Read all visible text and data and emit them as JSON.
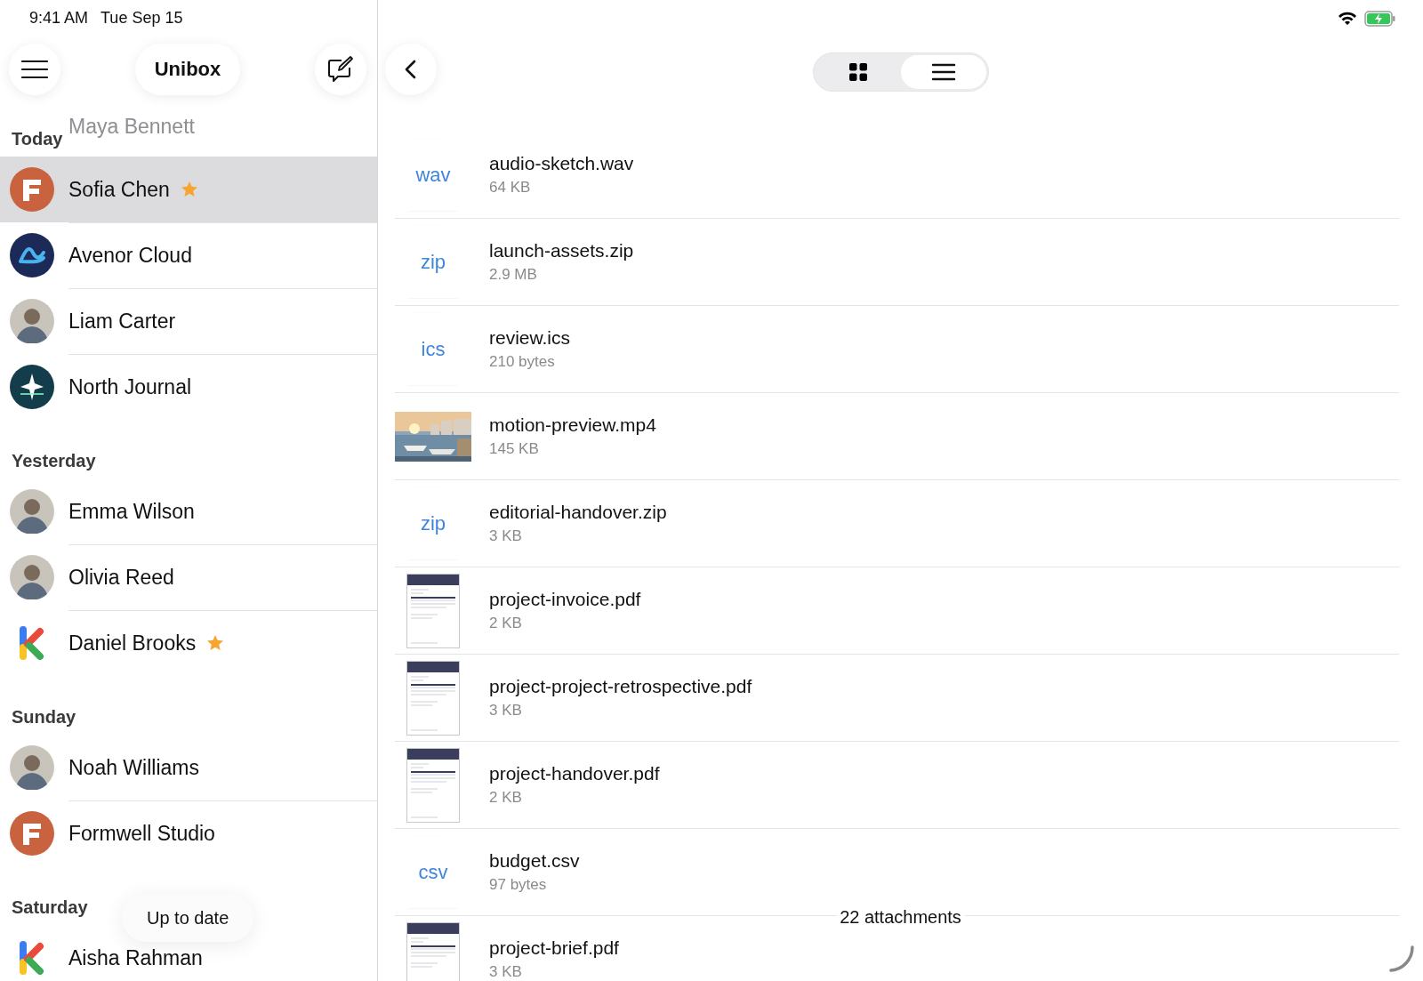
{
  "status_bar": {
    "time": "9:41 AM",
    "date": "Tue Sep 15"
  },
  "sidebar": {
    "title": "Unibox",
    "under_header": "Maya Bennett",
    "sections": [
      {
        "label": "Today",
        "contacts": [
          {
            "name": "Sofia Chen",
            "kind": "brand-f",
            "starred": true,
            "selected": true
          },
          {
            "name": "Avenor Cloud",
            "kind": "brand-loop",
            "starred": false,
            "selected": false
          },
          {
            "name": "Liam Carter",
            "kind": "person",
            "starred": false,
            "selected": false
          },
          {
            "name": "North Journal",
            "kind": "brand-star",
            "starred": false,
            "selected": false
          }
        ]
      },
      {
        "label": "Yesterday",
        "contacts": [
          {
            "name": "Emma Wilson",
            "kind": "person",
            "starred": false,
            "selected": false
          },
          {
            "name": "Olivia Reed",
            "kind": "person",
            "starred": false,
            "selected": false
          },
          {
            "name": "Daniel Brooks",
            "kind": "brand-k",
            "starred": true,
            "selected": false
          }
        ]
      },
      {
        "label": "Sunday",
        "contacts": [
          {
            "name": "Noah Williams",
            "kind": "person",
            "starred": false,
            "selected": false
          },
          {
            "name": "Formwell Studio",
            "kind": "brand-f",
            "starred": false,
            "selected": false
          }
        ]
      },
      {
        "label": "Saturday",
        "contacts": [
          {
            "name": "Aisha Rahman",
            "kind": "brand-k",
            "starred": false,
            "selected": false
          }
        ]
      }
    ]
  },
  "toast": "Up to date",
  "attachments": {
    "view_modes": [
      {
        "kind": "grid",
        "selected": false
      },
      {
        "kind": "list",
        "selected": true
      }
    ],
    "files": [
      {
        "name": "audio-sketch.wav",
        "size": "64 KB",
        "kind": "doc",
        "ext": "wav"
      },
      {
        "name": "launch-assets.zip",
        "size": "2.9 MB",
        "kind": "doc",
        "ext": "zip"
      },
      {
        "name": "review.ics",
        "size": "210 bytes",
        "kind": "doc",
        "ext": "ics"
      },
      {
        "name": "motion-preview.mp4",
        "size": "145 KB",
        "kind": "picture"
      },
      {
        "name": "editorial-handover.zip",
        "size": "3 KB",
        "kind": "doc",
        "ext": "zip"
      },
      {
        "name": "project-invoice.pdf",
        "size": "2 KB",
        "kind": "pdf"
      },
      {
        "name": "project-project-retrospective.pdf",
        "size": "3 KB",
        "kind": "pdf"
      },
      {
        "name": "project-handover.pdf",
        "size": "2 KB",
        "kind": "pdf"
      },
      {
        "name": "budget.csv",
        "size": "97 bytes",
        "kind": "doc",
        "ext": "csv"
      },
      {
        "name": "project-brief.pdf",
        "size": "3 KB",
        "kind": "pdf"
      }
    ],
    "count": "22 attachments"
  }
}
